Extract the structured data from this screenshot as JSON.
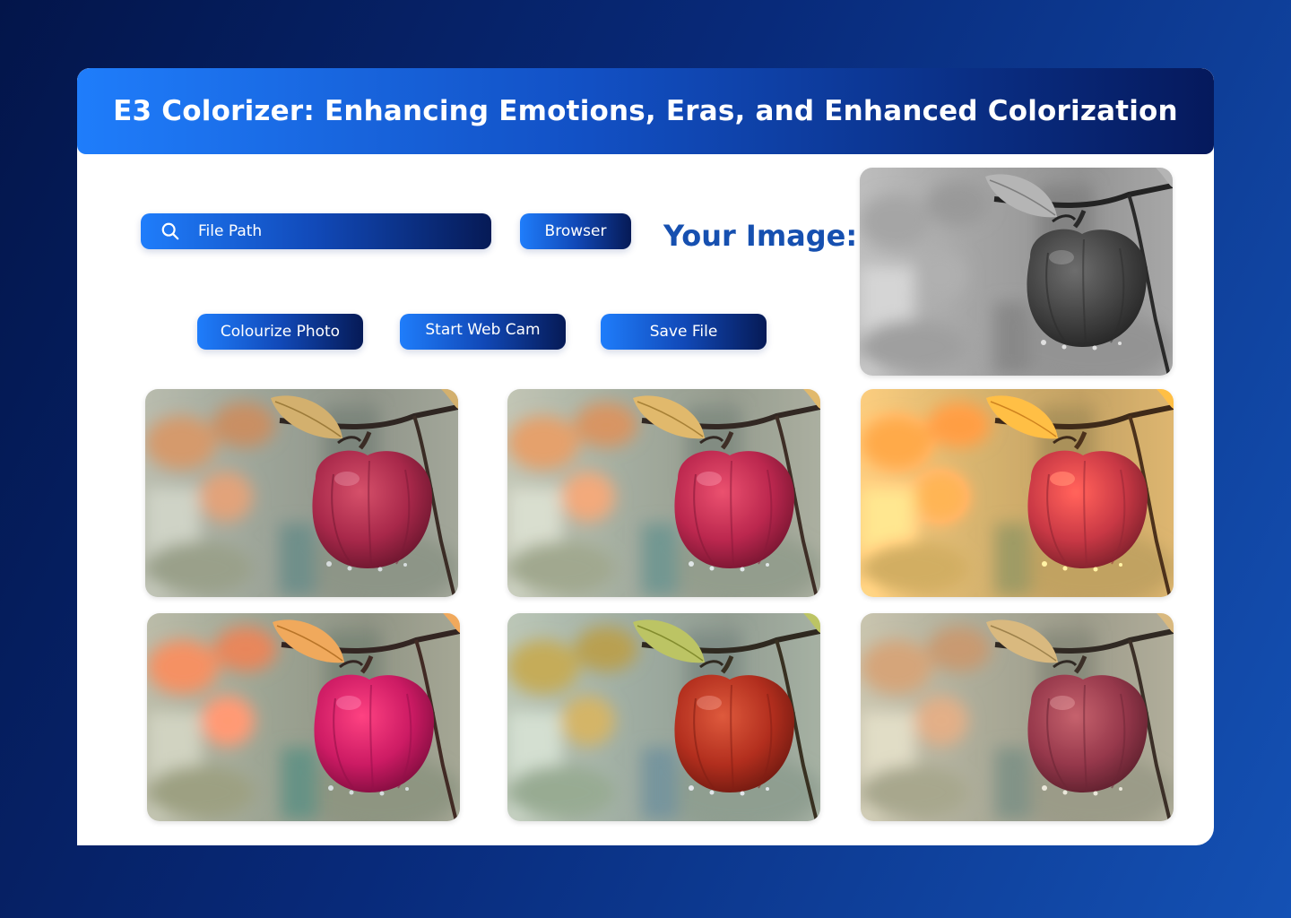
{
  "app": {
    "title": "E3 Colorizer: Enhancing Emotions, Eras, and Enhanced Colorization"
  },
  "search": {
    "placeholder": "File Path",
    "icon": "search-icon"
  },
  "buttons": {
    "browser": "Browser",
    "colourize": "Colourize Photo",
    "webcam": "Start Web Cam",
    "save": "Save File"
  },
  "preview": {
    "label": "Your Image:"
  },
  "colors": {
    "accent": "#1f7dfb",
    "accent_dark": "#061a56",
    "label": "#1650b0",
    "background": "#082a7a"
  },
  "results": [
    {
      "variant": "original-color"
    },
    {
      "variant": "soft-magenta"
    },
    {
      "variant": "warm-amber"
    },
    {
      "variant": "vivid-pink"
    },
    {
      "variant": "cool-blue"
    },
    {
      "variant": "muted-natural"
    }
  ]
}
